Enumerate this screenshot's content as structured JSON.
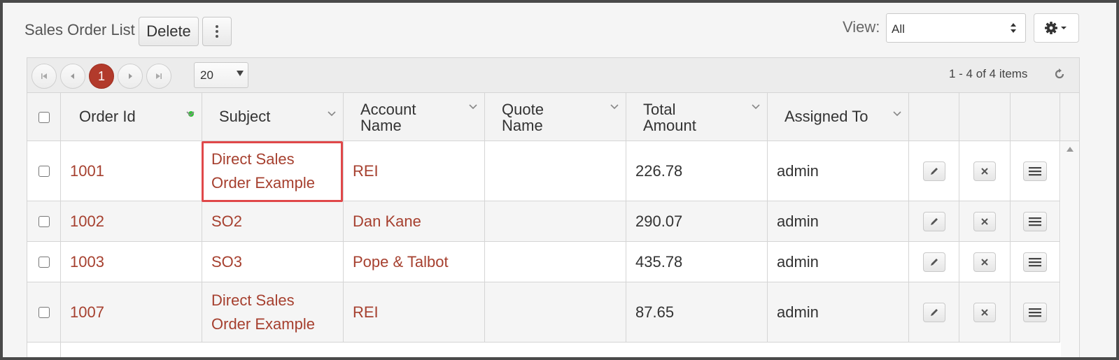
{
  "toolbar": {
    "title": "Sales Order List",
    "delete_label": "Delete",
    "view_label": "View:",
    "view_value": "All"
  },
  "pager": {
    "current_page": "1",
    "page_size": "20",
    "items_info": "1 - 4 of 4 items"
  },
  "columns": {
    "order_id": "Order Id",
    "subject": "Subject",
    "account_line1": "Account",
    "account_line2": "Name",
    "quote_line1": "Quote",
    "quote_line2": "Name",
    "total_line1": "Total",
    "total_line2": "Amount",
    "assigned_to": "Assigned To"
  },
  "rows": [
    {
      "order_id": "1001",
      "subject_line1": "Direct Sales",
      "subject_line2": "Order Example",
      "account": "REI",
      "quote": "",
      "total": "226.78",
      "assigned": "admin"
    },
    {
      "order_id": "1002",
      "subject_line1": "SO2",
      "subject_line2": "",
      "account": "Dan Kane",
      "quote": "",
      "total": "290.07",
      "assigned": "admin"
    },
    {
      "order_id": "1003",
      "subject_line1": "SO3",
      "subject_line2": "",
      "account": "Pope & Talbot",
      "quote": "",
      "total": "435.78",
      "assigned": "admin"
    },
    {
      "order_id": "1007",
      "subject_line1": "Direct Sales",
      "subject_line2": "Order Example",
      "account": "REI",
      "quote": "",
      "total": "87.65",
      "assigned": "admin"
    }
  ],
  "colors": {
    "link": "#a6402f",
    "active_page": "#b23a2b",
    "highlight": "#e0484a",
    "sort_indicator": "#2fc535"
  },
  "icons": {
    "more": "kebab-icon",
    "gear": "gear-icon",
    "edit": "pencil-icon",
    "delete": "close-icon",
    "menu": "hamburger-icon",
    "refresh": "refresh-icon"
  }
}
